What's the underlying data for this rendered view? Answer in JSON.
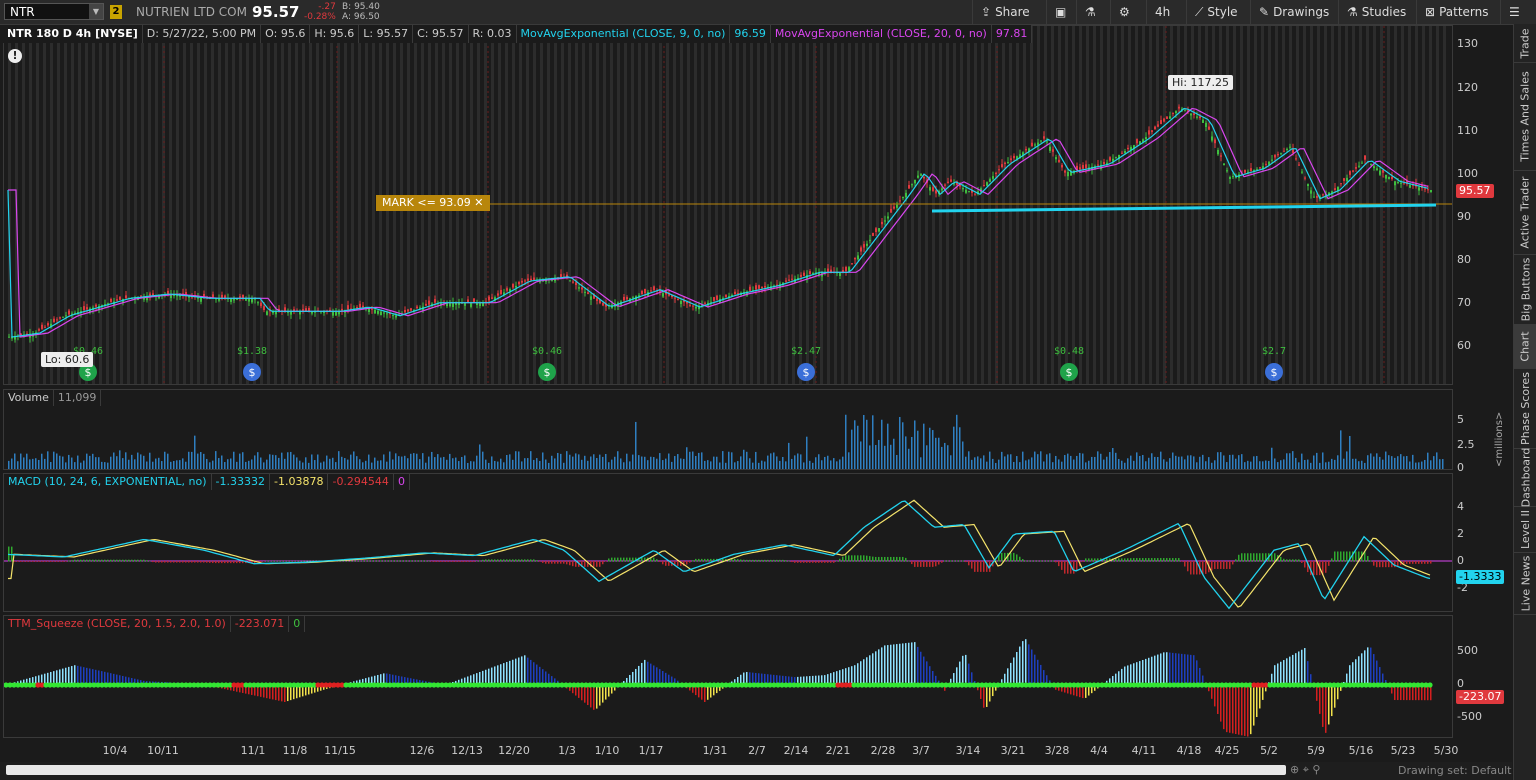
{
  "header": {
    "symbol": "NTR",
    "link_badge": "2",
    "company": "NUTRIEN LTD COM",
    "last": "95.57",
    "change": "-.27",
    "change_pct": "-0.28%",
    "bid": "B: 95.40",
    "ask": "A: 96.50",
    "share_label": "Share",
    "timeframe_label": "4h",
    "style_label": "Style",
    "drawings_label": "Drawings",
    "studies_label": "Studies",
    "patterns_label": "Patterns"
  },
  "legend": {
    "title": "NTR 180 D 4h [NYSE]",
    "date": "D: 5/27/22, 5:00 PM",
    "open": "O: 95.6",
    "high": "H: 95.6",
    "low": "L: 95.57",
    "close": "C: 95.57",
    "range": "R: 0.03",
    "ema9": "MovAvgExponential (CLOSE, 9, 0, no)",
    "ema9_val": "96.59",
    "ema20": "MovAvgExponential (CLOSE, 20, 0, no)",
    "ema20_val": "97.81"
  },
  "price_axis": {
    "ticks": [
      "130",
      "120",
      "110",
      "100",
      "90",
      "80",
      "70",
      "60"
    ],
    "last_tag": "95.57"
  },
  "annotations": {
    "hi": "Hi: 117.25",
    "lo": "Lo: 60.6",
    "mark": "MARK <= 93.09",
    "warning": "!"
  },
  "events": [
    {
      "label": "$0.46"
    },
    {
      "label": "$1.38"
    },
    {
      "label": "$0.46"
    },
    {
      "label": "$2.47"
    },
    {
      "label": "$0.48"
    },
    {
      "label": "$2.7"
    }
  ],
  "volume": {
    "label": "Volume",
    "value": "11,099",
    "ticks": [
      "5",
      "2.5",
      "0"
    ],
    "unit": "<millions>"
  },
  "macd": {
    "label": "MACD (10, 24, 6, EXPONENTIAL, no)",
    "v1": "-1.33332",
    "v2": "-1.03878",
    "v3": "-0.294544",
    "v4": "0",
    "ticks": [
      "4",
      "2",
      "0",
      "-2"
    ],
    "tag": "-1.3333"
  },
  "ttm": {
    "label": "TTM_Squeeze (CLOSE, 20, 1.5, 2.0, 1.0)",
    "v1": "-223.071",
    "v2": "0",
    "ticks": [
      "500",
      "0",
      "-500"
    ],
    "tag": "-223.07"
  },
  "x_axis": [
    "10/4",
    "10/11",
    "11/1",
    "11/8",
    "11/15",
    "12/6",
    "12/13",
    "12/20",
    "1/3",
    "1/10",
    "1/17",
    "1/31",
    "2/7",
    "2/14",
    "2/21",
    "2/28",
    "3/7",
    "3/14",
    "3/21",
    "3/28",
    "4/4",
    "4/11",
    "4/18",
    "4/25",
    "5/2",
    "5/9",
    "5/16",
    "5/23",
    "5/30"
  ],
  "right_tabs": [
    "Trade",
    "Times And Sales",
    "Active Trader",
    "Big Buttons",
    "Chart",
    "Phase Scores",
    "Dashboard",
    "Level II",
    "Live News"
  ],
  "bottom": {
    "drawing_set": "Drawing set: Default"
  },
  "colors": {
    "up": "#3fbf3f",
    "down": "#e0393e",
    "ema9": "#22d3ee",
    "ema20": "#d946ef",
    "mark": "#b8860b",
    "support": "#22d3ee"
  }
}
